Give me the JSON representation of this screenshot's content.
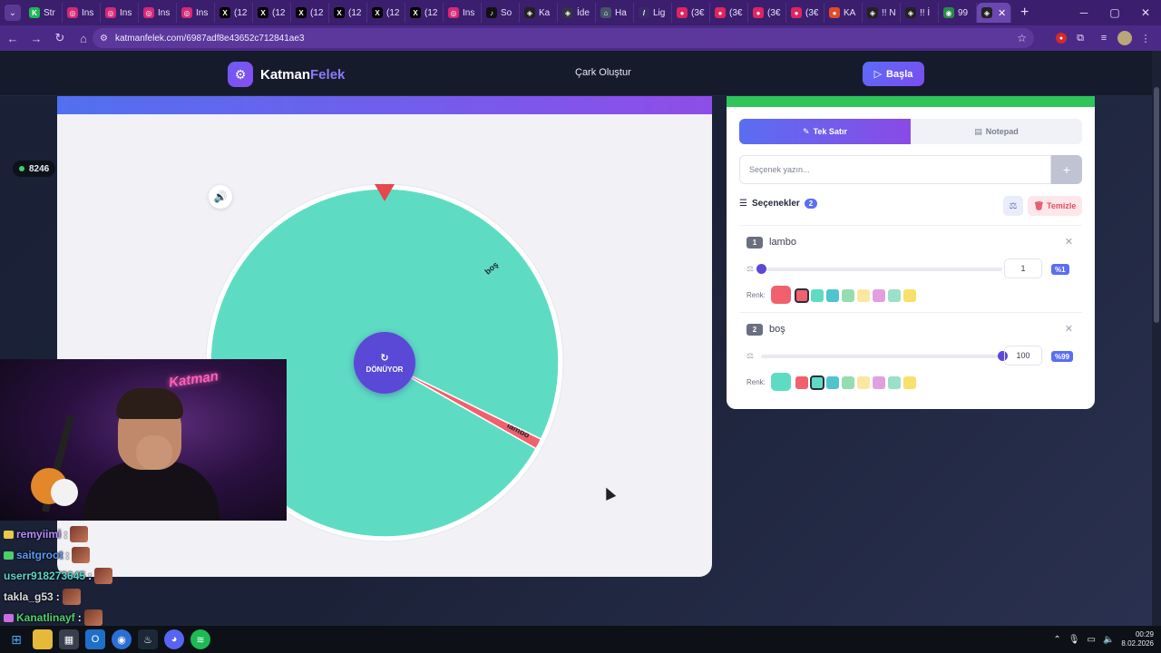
{
  "browser": {
    "tabs": [
      {
        "label": "Str",
        "fav_color": "#1db954",
        "fav_char": "K"
      },
      {
        "label": "Ins",
        "fav_color": "#d62976",
        "fav_char": "◎"
      },
      {
        "label": "Ins",
        "fav_color": "#d62976",
        "fav_char": "◎"
      },
      {
        "label": "Ins",
        "fav_color": "#d62976",
        "fav_char": "◎"
      },
      {
        "label": "Ins",
        "fav_color": "#d62976",
        "fav_char": "◎"
      },
      {
        "label": "(12",
        "fav_color": "#000000",
        "fav_char": "X"
      },
      {
        "label": "(12",
        "fav_color": "#000000",
        "fav_char": "X"
      },
      {
        "label": "(12",
        "fav_color": "#000000",
        "fav_char": "X"
      },
      {
        "label": "(12",
        "fav_color": "#000000",
        "fav_char": "X"
      },
      {
        "label": "(12",
        "fav_color": "#000000",
        "fav_char": "X"
      },
      {
        "label": "(12",
        "fav_color": "#000000",
        "fav_char": "X"
      },
      {
        "label": "Ins",
        "fav_color": "#d62976",
        "fav_char": "◎"
      },
      {
        "label": "So",
        "fav_color": "#111111",
        "fav_char": "♪"
      },
      {
        "label": "Ka",
        "fav_color": "#222222",
        "fav_char": "◈"
      },
      {
        "label": "İde",
        "fav_color": "#333344",
        "fav_char": "◈"
      },
      {
        "label": "Ha",
        "fav_color": "#445566",
        "fav_char": "⌂"
      },
      {
        "label": "Lig",
        "fav_color": "#3a2a6a",
        "fav_char": "/"
      },
      {
        "label": "(3€",
        "fav_color": "#e0245e",
        "fav_char": "●"
      },
      {
        "label": "(3€",
        "fav_color": "#e0245e",
        "fav_char": "●"
      },
      {
        "label": "(3€",
        "fav_color": "#e0245e",
        "fav_char": "●"
      },
      {
        "label": "(3€",
        "fav_color": "#e0245e",
        "fav_char": "●"
      },
      {
        "label": "KA",
        "fav_color": "#e04a2a",
        "fav_char": "●"
      },
      {
        "label": "!! N",
        "fav_color": "#222222",
        "fav_char": "◈"
      },
      {
        "label": "!! İ",
        "fav_color": "#222222",
        "fav_char": "◈"
      },
      {
        "label": "99",
        "fav_color": "#2a8a4a",
        "fav_char": "◉"
      }
    ],
    "active_tab_fav": "◈",
    "url": "katmanfelek.com/6987adf8e43652c712841ae3"
  },
  "header": {
    "logo_main": "Katman",
    "logo_accent": "Felek",
    "nav_link": "Çark Oluştur",
    "start_button": "Başla"
  },
  "stream": {
    "viewer_count": "8246",
    "webcam_neon": "Katman"
  },
  "wheel": {
    "center_label": "DÖNÜYOR",
    "segments": [
      {
        "label": "lambo",
        "weight": 1,
        "color": "#f0616d"
      },
      {
        "label": "boş",
        "weight": 100,
        "color": "#5edcc3"
      }
    ],
    "pointer_color": "#e5484d"
  },
  "panel": {
    "mode_tabs": [
      "Tek Satır",
      "Notepad"
    ],
    "input_placeholder": "Seçenek yazın...",
    "options_title": "Seçenekler",
    "options_count": "2",
    "clear_button": "Temizle",
    "color_label": "Renk:",
    "palette": [
      "#f0616d",
      "#5edcc3",
      "#4fc4cf",
      "#96dcb0",
      "#fbe7a1",
      "#e29fe0",
      "#9be0c8",
      "#f9e06b"
    ],
    "options": [
      {
        "num": "1",
        "name": "lambo",
        "weight": "1",
        "percent": "%1",
        "slider_fraction": 0.0,
        "color": "#f0616d",
        "selected_swatch": 0
      },
      {
        "num": "2",
        "name": "boş",
        "weight": "100",
        "percent": "%99",
        "slider_fraction": 1.0,
        "color": "#5edcc3",
        "selected_swatch": 1
      }
    ]
  },
  "chat": [
    {
      "user": "remyiimi",
      "color": "#b58cff",
      "badge": "#e8c94a"
    },
    {
      "user": "saitgroot",
      "color": "#5b9bf5",
      "badge": "#4ad16a"
    },
    {
      "user": "userr918273645",
      "color": "#5ed6c8",
      "badge": ""
    },
    {
      "user": "takla_g53",
      "color": "#dcdcdc",
      "badge": ""
    },
    {
      "user": "Kanatlinayf",
      "color": "#4fd16e",
      "badge": "#c86ee0"
    }
  ],
  "taskbar": {
    "time": "00:29",
    "date": "8.02.2026"
  }
}
